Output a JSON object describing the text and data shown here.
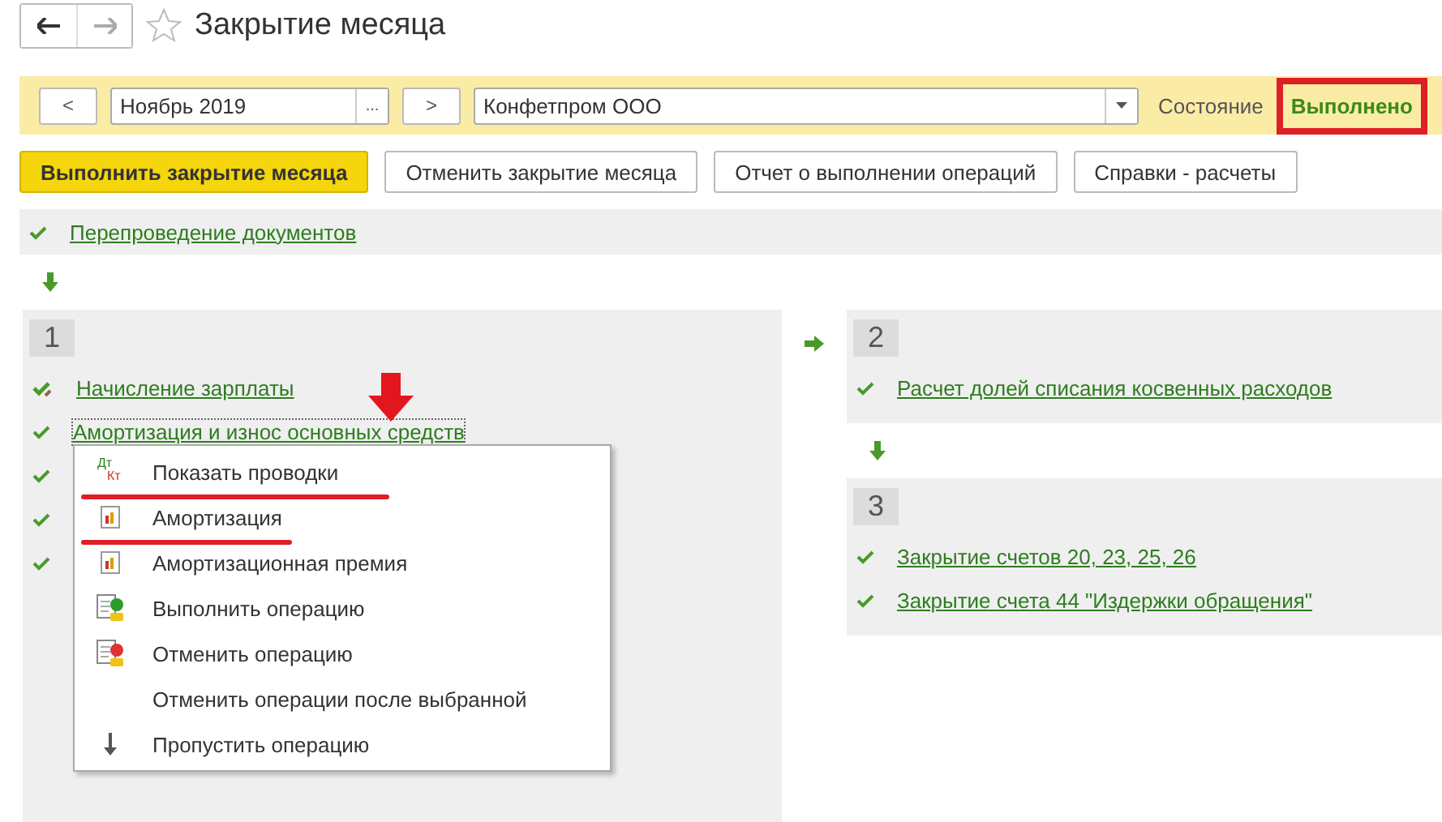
{
  "window": {
    "title": "Закрытие месяца",
    "favorite": false
  },
  "period": {
    "prev": "<",
    "value": "Ноябрь 2019",
    "choose": "...",
    "next": ">"
  },
  "organization": {
    "value": "Конфетпром ООО"
  },
  "state": {
    "label": "Состояние",
    "value": "Выполнено",
    "highlighted": true
  },
  "buttons": [
    {
      "label": "Выполнить закрытие месяца",
      "primary": true
    },
    {
      "label": "Отменить закрытие месяца",
      "primary": false
    },
    {
      "label": "Отчет о выполнении операций",
      "primary": false
    },
    {
      "label": "Справки - расчеты",
      "primary": false
    }
  ],
  "pre_step": {
    "label": "Перепроведение документов",
    "done": true,
    "edited": false
  },
  "groups": [
    {
      "number": "1",
      "items": [
        {
          "label": "Начисление зарплаты",
          "done": true,
          "edited": true
        },
        {
          "label": "Амортизация и износ основных средств",
          "done": true,
          "edited": false,
          "focused": true
        },
        {
          "done": true,
          "edited": false
        },
        {
          "done": true,
          "edited": false
        },
        {
          "done": true,
          "edited": false
        }
      ]
    },
    {
      "number": "2",
      "items": [
        {
          "label": "Расчет долей списания косвенных расходов",
          "done": true,
          "edited": false
        }
      ]
    },
    {
      "number": "3",
      "items": [
        {
          "label": "Закрытие счетов 20, 23, 25, 26",
          "done": true,
          "edited": false
        },
        {
          "label": "Закрытие счета 44 \"Издержки обращения\"",
          "done": true,
          "edited": false
        }
      ]
    }
  ],
  "context_menu": {
    "items": [
      {
        "label": "Показать проводки",
        "kind": "entries",
        "icon_top": "Дт",
        "icon_bottom": "Кт",
        "underlined": true
      },
      {
        "label": "Амортизация",
        "kind": "report",
        "underlined": true
      },
      {
        "label": "Амортизационная премия",
        "kind": "report",
        "underlined": false
      },
      {
        "label": "Выполнить операцию",
        "kind": "run",
        "underlined": false
      },
      {
        "label": "Отменить операцию",
        "kind": "cancel",
        "underlined": false
      },
      {
        "label": "Отменить операции после выбранной",
        "kind": "plain",
        "underlined": false
      },
      {
        "label": "Пропустить операцию",
        "kind": "skip",
        "underlined": false
      }
    ]
  }
}
